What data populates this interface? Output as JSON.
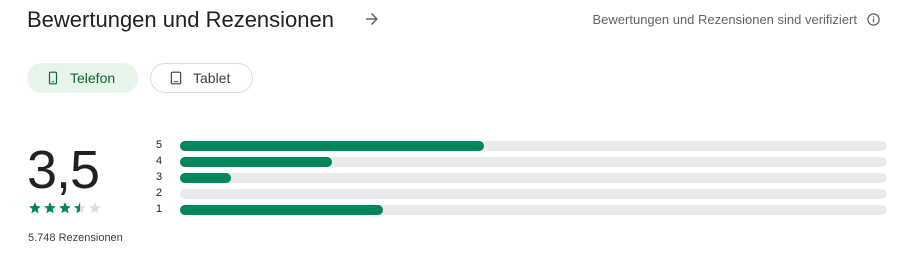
{
  "header": {
    "title": "Bewertungen und Rezensionen",
    "verified_text": "Bewertungen und Rezensionen sind verifiziert",
    "arrow_icon": "arrow-right-icon",
    "info_icon": "info-icon"
  },
  "chips": [
    {
      "label": "Telefon",
      "icon": "phone-icon",
      "selected": true
    },
    {
      "label": "Tablet",
      "icon": "tablet-icon",
      "selected": false
    }
  ],
  "rating": {
    "score": "3,5",
    "stars": 3.5,
    "max_stars": 5,
    "reviews_count": "5.748 Rezensionen"
  },
  "distribution": [
    {
      "label": "5",
      "fraction": 0.43
    },
    {
      "label": "4",
      "fraction": 0.215
    },
    {
      "label": "3",
      "fraction": 0.072
    },
    {
      "label": "2",
      "fraction": 0.0
    },
    {
      "label": "1",
      "fraction": 0.287
    }
  ],
  "colors": {
    "accent": "#01875f",
    "track": "#e8eaed",
    "chip_selected_bg": "#e6f4ea",
    "chip_selected_text": "#0d652d",
    "star_empty": "#e0e0e0"
  }
}
